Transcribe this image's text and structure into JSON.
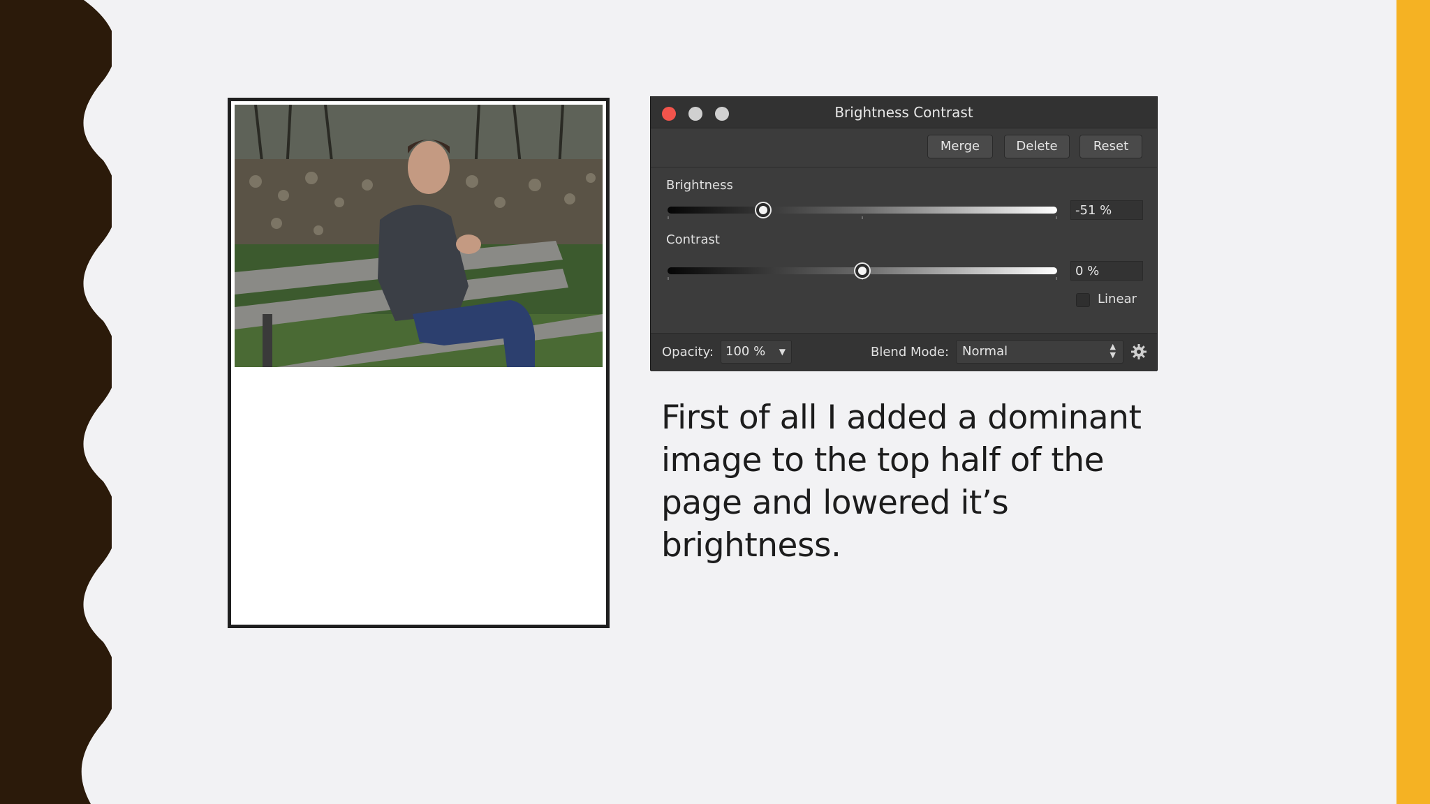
{
  "slide": {
    "caption": "First of all I added a dominant image to the top half of the page and lowered it’s brightness."
  },
  "panel": {
    "title": "Brightness Contrast",
    "buttons": {
      "merge": "Merge",
      "delete": "Delete",
      "reset": "Reset"
    },
    "brightness": {
      "label": "Brightness",
      "value_text": "-51 %",
      "value": -51
    },
    "contrast": {
      "label": "Contrast",
      "value_text": "0 %",
      "value": 0
    },
    "linear": {
      "label": "Linear",
      "checked": false
    },
    "opacity": {
      "label": "Opacity:",
      "value": "100 %"
    },
    "blend_mode": {
      "label": "Blend Mode:",
      "value": "Normal"
    }
  },
  "colors": {
    "accent_right_bar": "#f5b223",
    "left_wave": "#2b1a0a",
    "close_button": "#f2544c",
    "panel_bg": "#3c3c3c"
  },
  "icons": [
    "close-window-icon",
    "minimize-window-icon",
    "maximize-window-icon",
    "dropdown-arrow-icon",
    "updown-arrows-icon",
    "gear-icon"
  ]
}
